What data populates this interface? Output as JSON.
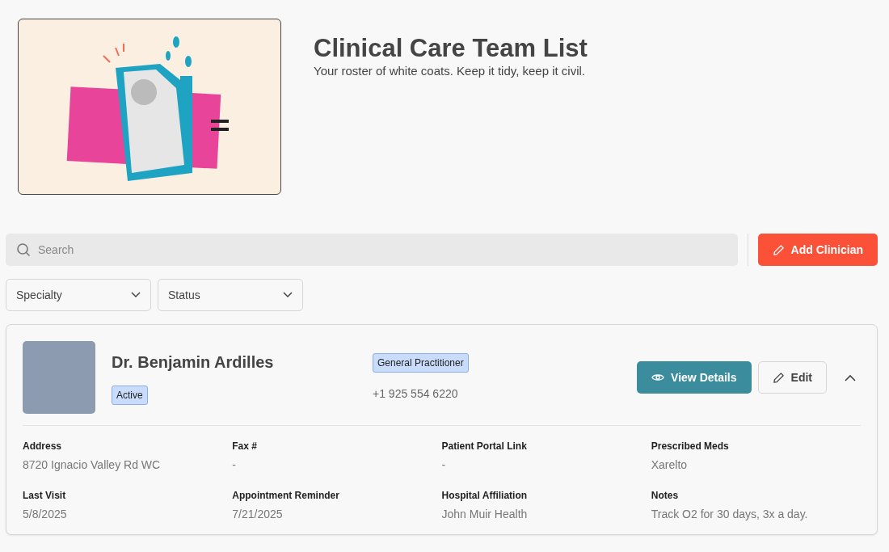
{
  "header": {
    "title": "Clinical Care Team List",
    "subtitle": "Your roster of white coats. Keep it tidy, keep it civil."
  },
  "search": {
    "placeholder": "Search"
  },
  "add_button": {
    "label": "Add Clinician"
  },
  "filters": [
    {
      "label": "Specialty"
    },
    {
      "label": "Status"
    }
  ],
  "clinicians": [
    {
      "name": "Dr. Benjamin Ardilles",
      "status": "Active",
      "specialty": "General Practitioner",
      "phone": "+1 925 554 6220",
      "expanded": true,
      "actions": [
        {
          "kind": "view",
          "label": "View Details"
        },
        {
          "kind": "edit",
          "label": "Edit"
        }
      ],
      "details": [
        {
          "label": "Address",
          "value": "8720 Ignacio Valley Rd WC"
        },
        {
          "label": "Fax #",
          "value": "-"
        },
        {
          "label": "Patient Portal Link",
          "value": "-"
        },
        {
          "label": "Prescribed Meds",
          "value": "Xarelto"
        },
        {
          "label": "Last Visit",
          "value": "5/8/2025"
        },
        {
          "label": "Appointment Reminder",
          "value": "7/21/2025"
        },
        {
          "label": "Hospital Affiliation",
          "value": "John Muir Health"
        },
        {
          "label": "Notes",
          "value": "Track O2 for 30 days, 3x a day."
        }
      ]
    }
  ]
}
